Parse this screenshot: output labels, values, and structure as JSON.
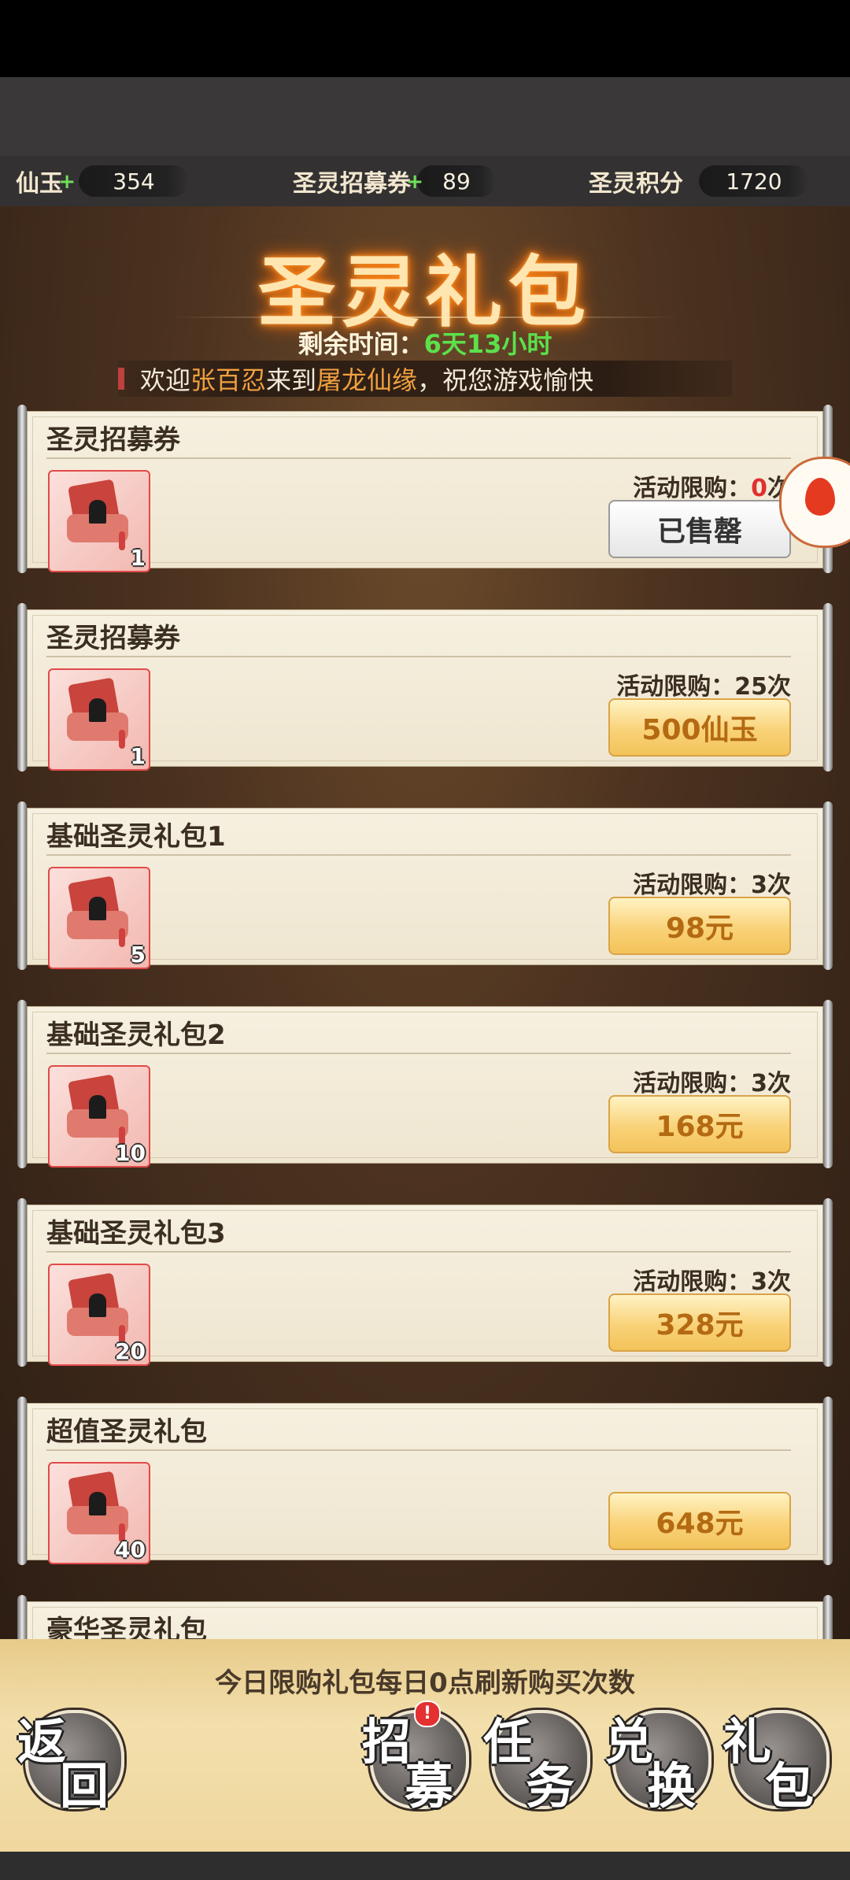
{
  "currency": [
    {
      "label": "仙玉",
      "value": "354",
      "plus": "+"
    },
    {
      "label": "圣灵招募券",
      "value": "89",
      "plus": "+"
    },
    {
      "label": "圣灵积分",
      "value": "1720"
    }
  ],
  "title": "圣灵礼包",
  "remaining": {
    "label": "剩余时间：",
    "value": "6天13小时"
  },
  "marquee": {
    "pre": "欢迎",
    "user": "张百忍",
    "mid": "来到",
    "game": "屠龙仙缘",
    "post": "，祝您游戏愉快"
  },
  "limit_label": "活动限购：",
  "packs": [
    {
      "name": "圣灵招募券",
      "count": "1",
      "limit": "0",
      "limit_suffix": "次",
      "button": "已售罄"
    },
    {
      "name": "圣灵招募券",
      "count": "1",
      "limit": "25次",
      "button": "500仙玉"
    },
    {
      "name": "基础圣灵礼包1",
      "count": "5",
      "limit": "3次",
      "button": "98元"
    },
    {
      "name": "基础圣灵礼包2",
      "count": "10",
      "limit": "3次",
      "button": "168元"
    },
    {
      "name": "基础圣灵礼包3",
      "count": "20",
      "limit": "3次",
      "button": "328元"
    },
    {
      "name": "超值圣灵礼包",
      "count": "40",
      "button": "648元"
    },
    {
      "name": "豪华圣灵礼包"
    }
  ],
  "notice": "今日限购礼包每日0点刷新购买次数",
  "nav": [
    {
      "c1": "返",
      "c2": "回"
    },
    {
      "c1": "招",
      "c2": "募",
      "badge": "!"
    },
    {
      "c1": "任",
      "c2": "务"
    },
    {
      "c1": "兑",
      "c2": "换"
    },
    {
      "c1": "礼",
      "c2": "包"
    }
  ]
}
